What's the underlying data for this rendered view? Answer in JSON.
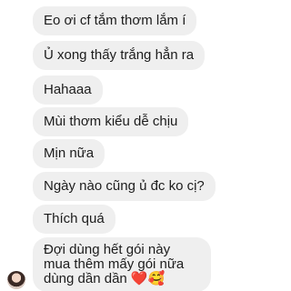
{
  "messages": [
    {
      "text": "Eo ơi cf tắm thơm lắm í"
    },
    {
      "text": "Ủ xong thấy trắng hẳn ra"
    },
    {
      "text": "Hahaaa"
    },
    {
      "text": "Mùi thơm kiểu dễ chịu"
    },
    {
      "text": "Mịn nữa"
    },
    {
      "text": "Ngày nào cũng ủ đc ko cị?"
    },
    {
      "text": "Thích quá"
    },
    {
      "text": "Đợi dùng hết gói này mua thêm mấy gói nữa dùng dần dần ❤️🥰"
    }
  ],
  "avatar": {
    "icon": "profile-photo"
  }
}
